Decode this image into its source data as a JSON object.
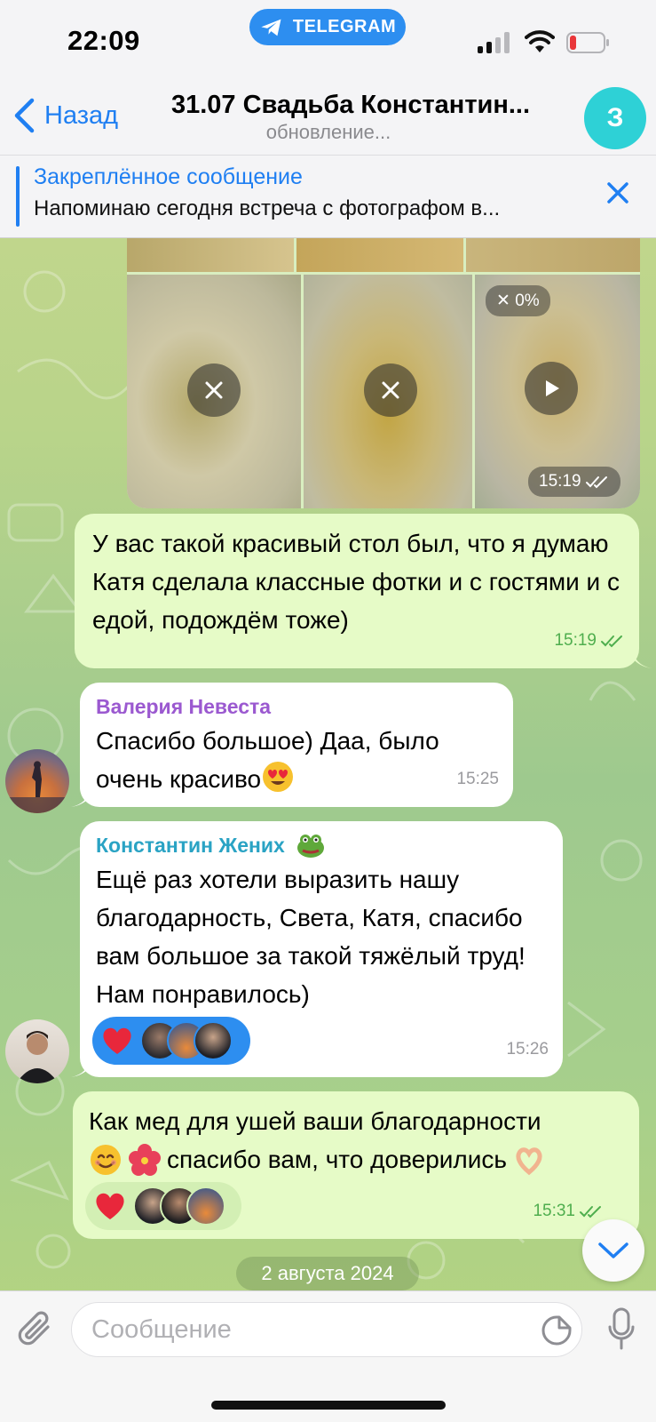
{
  "status": {
    "time": "22:09",
    "app_pill": "TELEGRAM"
  },
  "header": {
    "back_label": "Назад",
    "title": "31.07 Свадьба Константин...",
    "subtitle": "обновление...",
    "avatar_letter": "З"
  },
  "pinned": {
    "title": "Закреплённое сообщение",
    "text": "Напоминаю сегодня встреча с фотографом в..."
  },
  "media": {
    "progress_label": "✕ 0%",
    "time": "15:19"
  },
  "messages": [
    {
      "direction": "out",
      "text": "У вас такой красивый стол был, что я думаю Катя сделала классные фотки и с гостями и с едой, подождём тоже)",
      "time": "15:19"
    },
    {
      "direction": "in",
      "sender": "Валерия Невеста",
      "text": "Спасибо большое) Даа, было очень красиво",
      "emoji": "heart-eyes-emoji",
      "time": "15:25"
    },
    {
      "direction": "in",
      "sender": "Константин Жених",
      "text": "Ещё раз хотели выразить нашу благодарность, Света, Катя, спасибо вам большое за такой тяжёлый труд! Нам понравилось)",
      "reaction": "heart",
      "time": "15:26"
    },
    {
      "direction": "out",
      "text_part1": "Как мед для ушей ваши благодарности",
      "text_part2": "спасибо вам, что доверились",
      "reaction": "heart",
      "time": "15:31"
    }
  ],
  "date_separator": "2 августа 2024",
  "composer": {
    "placeholder": "Сообщение"
  },
  "colors": {
    "accent": "#1f7ff2",
    "out_bubble": "#e6fbc7",
    "in_bubble": "#ffffff",
    "sender_bride": "#9b59d0",
    "sender_groom": "#2aa3c4",
    "telegram_pill": "#2d8ef0",
    "group_avatar": "#2ed1d6"
  },
  "icons": [
    "telegram-icon",
    "signal-icon",
    "wifi-icon",
    "battery-icon",
    "back-chevron-icon",
    "close-icon",
    "play-icon",
    "double-check-icon",
    "chevron-down-icon",
    "paperclip-icon",
    "sticker-icon",
    "microphone-icon"
  ]
}
